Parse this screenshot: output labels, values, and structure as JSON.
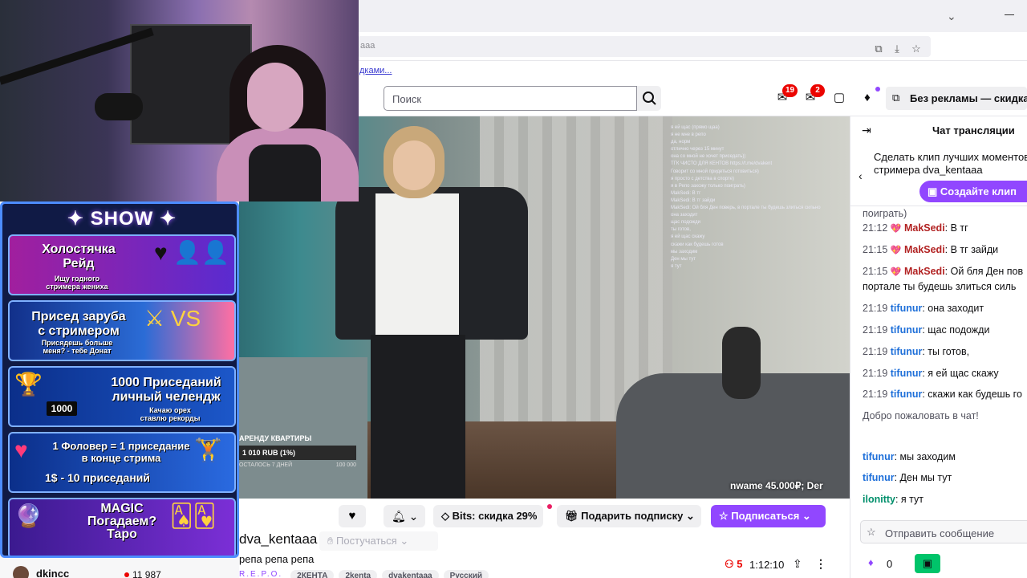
{
  "browser": {
    "address_fragment": "aaa",
    "bookmark_fragment": "дками..."
  },
  "topnav": {
    "search_placeholder": "Поиск",
    "notifications_count": "19",
    "inbox_count": "2",
    "adfree_label": "Без рекламы — скидка"
  },
  "overlay": {
    "show_title": "SHOW",
    "cards": [
      {
        "title": "Холостячка\nРейд",
        "subtitle": "Ищу годного\nстримера жениха"
      },
      {
        "title": "Присед заруба\nс стримером",
        "subtitle": "Присядешь больше\nменя? - тебе Донат"
      },
      {
        "title": "1000 Приседаний\nличный челендж",
        "subtitle": "Качаю орех\nставлю рекорды",
        "badge": "1000"
      },
      {
        "title": "1 Фоловер = 1 приседание\nв конце стрима",
        "subtitle": "1$ - 10 приседаний"
      },
      {
        "title": "MAGIC\nПогадаем?\nТаро",
        "subtitle": ""
      }
    ]
  },
  "video": {
    "donation_title": "АРЕНДУ КВАРТИРЫ",
    "donation_amount": "1 010 RUB (1%)",
    "donation_left": "ОСТАЛОСЬ 7 ДНЕЙ",
    "donation_goal": "100 000",
    "ticker": "nwame 45.000₽; Der",
    "overlay_chat": [
      "я ей щас (прямо щаа)",
      "я не мне в репо",
      "да, норм",
      "отлично через 15 минут",
      "она со мной не хочет приседать))",
      "ТГК ЧИСТО ДЛЯ КЕНТОВ https://t.me/dvakent",
      "Говорит со мной придеться готовиться)",
      "я просто с детства в спорте)",
      "я в Репо захожу только поиграть)",
      "MakSedi: В тг",
      "MakSedi: В тг зайди",
      "MakSedi: Ой бля Ден поверь, в портале ты будешь злиться сильно",
      "она заходит",
      "щас подожди",
      "ты готов,",
      "я ей щас скажу",
      "скажи как будешь готов",
      "мы заходим",
      "Ден мы тут",
      "я тут"
    ]
  },
  "actions": {
    "bits_label": "Bits: скидка 29%",
    "gift_label": "Подарить подписку",
    "subscribe_label": "Подписаться"
  },
  "stream": {
    "channel_name": "dva_kentaaa",
    "knock_label": "Постучаться",
    "title": "репа репа репа",
    "category": "R.E.P.O.",
    "tags": [
      "2КЕНТА",
      "2kenta",
      "dvakentaaa",
      "Русский"
    ],
    "viewers": "5",
    "uptime": "1:12:10"
  },
  "sidebar": {
    "channel": "dkincc",
    "viewers": "11 987"
  },
  "chat": {
    "header": "Чат трансляции",
    "promo_text": "Сделать клип лучших моментов стримера dva_kentaaa",
    "clip_button": "Создайте клип",
    "partial_line": "поиграть)",
    "messages": [
      {
        "time": "21:12",
        "user": "MakSedi",
        "text": "В тг",
        "color": "red",
        "heart": true
      },
      {
        "time": "21:15",
        "user": "MakSedi",
        "text": "В тг зайди",
        "color": "red",
        "heart": true
      },
      {
        "time": "21:15",
        "user": "MakSedi",
        "text": "Ой бля Ден пов",
        "color": "red",
        "heart": true
      },
      {
        "time": "",
        "user": "",
        "text": "портале ты будешь злиться силь",
        "color": "none",
        "heart": false
      },
      {
        "time": "21:19",
        "user": "tifunur",
        "text": "она заходит",
        "color": "blue",
        "heart": false
      },
      {
        "time": "21:19",
        "user": "tifunur",
        "text": "щас подожди",
        "color": "blue",
        "heart": false
      },
      {
        "time": "21:19",
        "user": "tifunur",
        "text": "ты готов,",
        "color": "blue",
        "heart": false
      },
      {
        "time": "21:19",
        "user": "tifunur",
        "text": "я ей щас скажу",
        "color": "blue",
        "heart": false
      },
      {
        "time": "21:19",
        "user": "tifunur",
        "text": "скажи как будешь го",
        "color": "blue",
        "heart": false
      },
      {
        "time": "",
        "user": "",
        "text": "Добро пожаловать в чат!",
        "color": "none",
        "heart": false
      },
      {
        "time": "",
        "user": "tifunur",
        "text": "мы заходим",
        "color": "blue",
        "heart": false
      },
      {
        "time": "",
        "user": "tifunur",
        "text": "Ден мы тут",
        "color": "blue",
        "heart": false
      },
      {
        "time": "",
        "user": "ilonitty",
        "text": "я тут",
        "color": "green",
        "heart": false
      }
    ],
    "composer_placeholder": "Отправить сообщение",
    "points": "0"
  }
}
